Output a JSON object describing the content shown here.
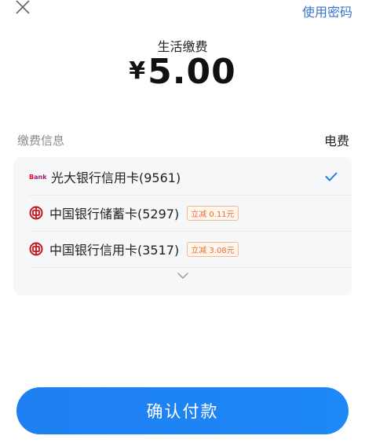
{
  "header": {
    "close_icon": "close-icon",
    "use_password_label": "使用密码"
  },
  "payment": {
    "title": "生活缴费",
    "currency": "¥",
    "amount": "5.00"
  },
  "info": {
    "label": "缴费信息",
    "value": "电费"
  },
  "cards": [
    {
      "name": "光大银行信用卡(9561)",
      "logo_text": "Bank",
      "selected": true,
      "promo": ""
    },
    {
      "name": "中国银行储蓄卡(5297)",
      "logo_text": "",
      "selected": false,
      "promo": "立减 0.11元"
    },
    {
      "name": "中国银行信用卡(3517)",
      "logo_text": "",
      "selected": false,
      "promo": "立减 3.08元"
    }
  ],
  "expand_icon": "chevron-down-icon",
  "confirm_label": "确认付款",
  "colors": {
    "primary": "#1f7ff2",
    "link": "#3a74c9",
    "promo": "#e8702a",
    "boc_red": "#c8161d",
    "ceb_purple": "#9b1d7a"
  }
}
